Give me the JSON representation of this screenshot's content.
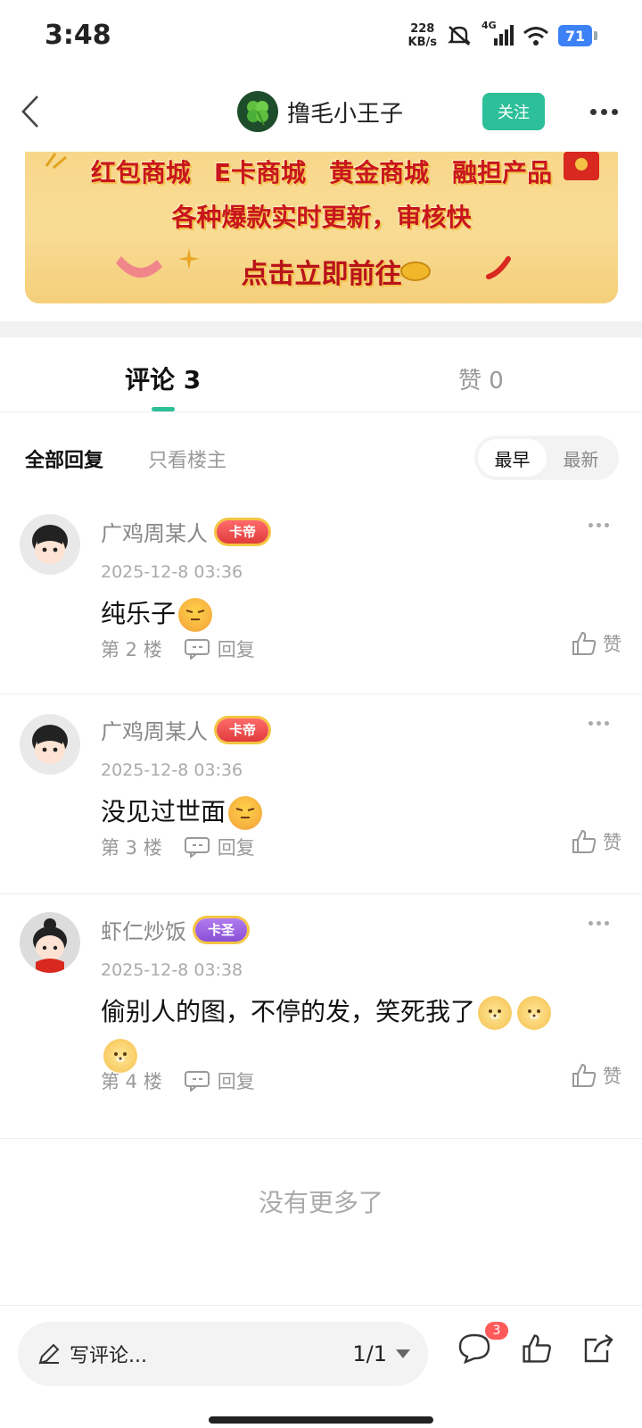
{
  "status_bar": {
    "time": "3:48",
    "net_speed_value": "228",
    "net_speed_unit": "KB/s",
    "network": "4G",
    "battery": "71"
  },
  "header": {
    "author_name": "撸毛小王子",
    "follow_label": "关注"
  },
  "banner": {
    "items": [
      "红包商城",
      "E卡商城",
      "黄金商城",
      "融担产品"
    ],
    "tagline": "各种爆款实时更新，审核快",
    "cta": "点击立即前往"
  },
  "tabs": {
    "comments": "评论 3",
    "likes": "赞 0"
  },
  "filters": {
    "all": "全部回复",
    "op_only": "只看楼主",
    "sort_earliest": "最早",
    "sort_latest": "最新"
  },
  "comments": [
    {
      "name": "广鸡周某人",
      "badge": "卡帝",
      "time": "2025-12-8 03:36",
      "text": "纯乐子",
      "floor": "第 2 楼",
      "reply_label": "回复",
      "like_label": "赞"
    },
    {
      "name": "广鸡周某人",
      "badge": "卡帝",
      "time": "2025-12-8 03:36",
      "text": "没见过世面",
      "floor": "第 3 楼",
      "reply_label": "回复",
      "like_label": "赞"
    },
    {
      "name": "虾仁炒饭",
      "badge": "卡圣",
      "time": "2025-12-8 03:38",
      "text": "偷别人的图，不停的发，笑死我了",
      "floor": "第 4 楼",
      "reply_label": "回复",
      "like_label": "赞"
    }
  ],
  "no_more": "没有更多了",
  "bottom_bar": {
    "input_placeholder": "写评论...",
    "page": "1/1",
    "comment_count": "3"
  },
  "colors": {
    "accent": "#2dbf99",
    "badge_red": "#e03b3b",
    "badge_purple": "#8a4fd6",
    "battery": "#3c82f6"
  }
}
